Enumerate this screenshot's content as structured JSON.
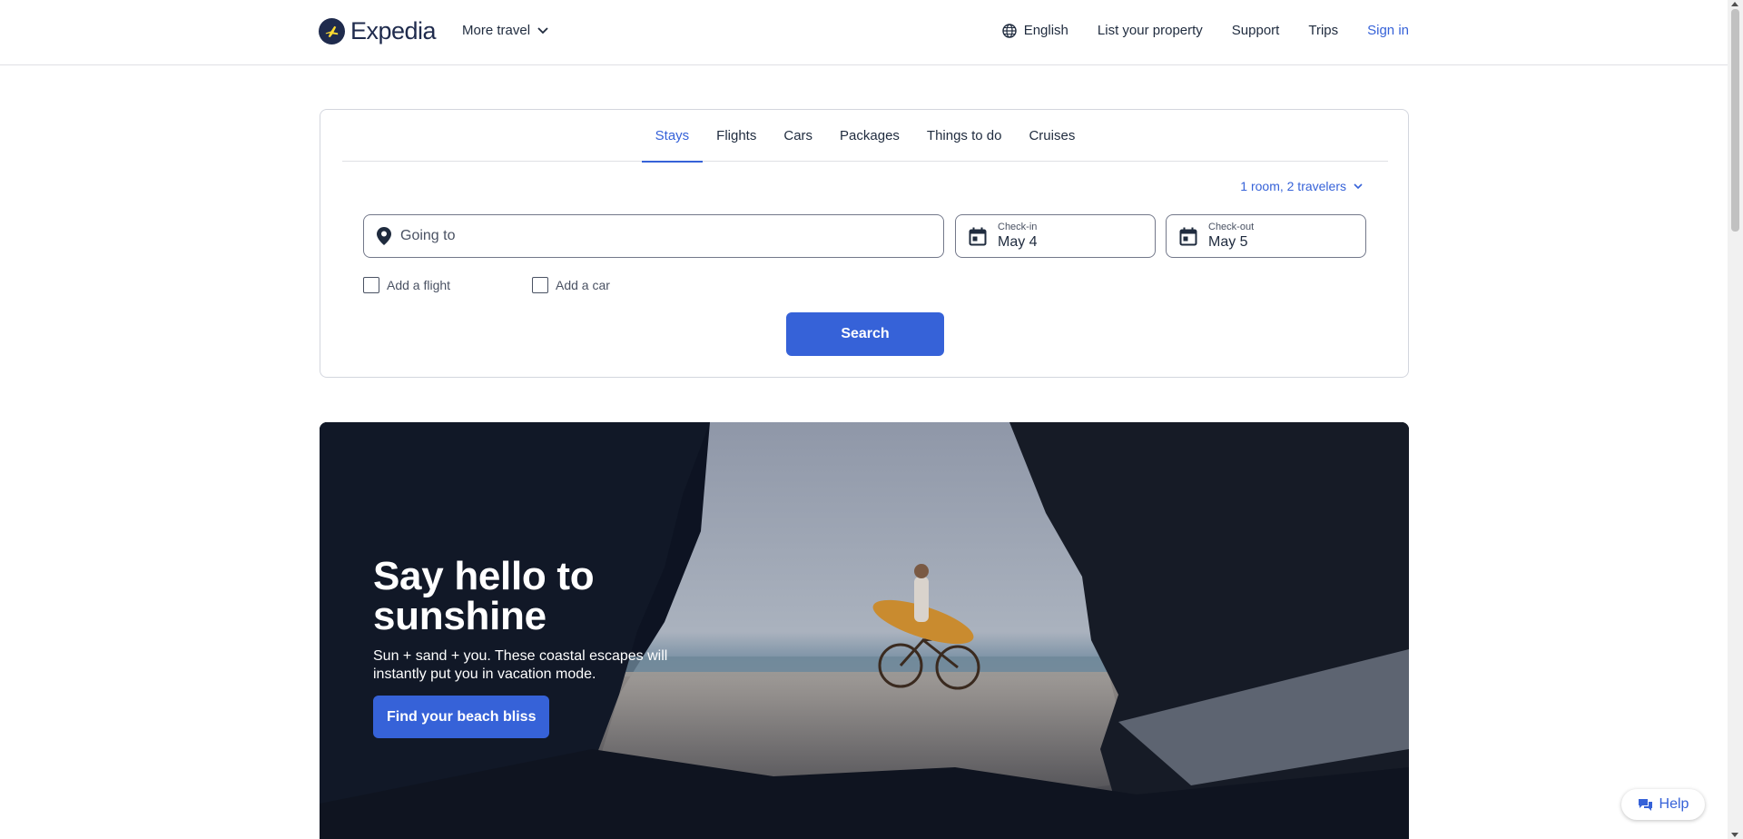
{
  "colors": {
    "accent": "#3662d8",
    "brand_navy": "#1f2b4d",
    "text": "#1f2b3e",
    "border": "#d3d6de"
  },
  "header": {
    "logo_text": "Expedia",
    "logo_icon": "plane-globe-icon",
    "more_travel": "More travel",
    "language": "English",
    "list_property": "List your property",
    "support": "Support",
    "trips": "Trips",
    "sign_in": "Sign in"
  },
  "search": {
    "tabs": [
      {
        "label": "Stays",
        "active": true
      },
      {
        "label": "Flights",
        "active": false
      },
      {
        "label": "Cars",
        "active": false
      },
      {
        "label": "Packages",
        "active": false
      },
      {
        "label": "Things to do",
        "active": false
      },
      {
        "label": "Cruises",
        "active": false
      }
    ],
    "travelers": "1 room, 2 travelers",
    "going_to_placeholder": "Going to",
    "checkin_label": "Check-in",
    "checkin_value": "May 4",
    "checkout_label": "Check-out",
    "checkout_value": "May 5",
    "add_flight": "Add a flight",
    "add_car": "Add a car",
    "search_button": "Search"
  },
  "hero": {
    "title": "Say hello to sunshine",
    "subtitle": "Sun + sand + you. These coastal escapes will instantly put you in vacation mode.",
    "cta": "Find your beach bliss"
  },
  "help": {
    "label": "Help"
  }
}
